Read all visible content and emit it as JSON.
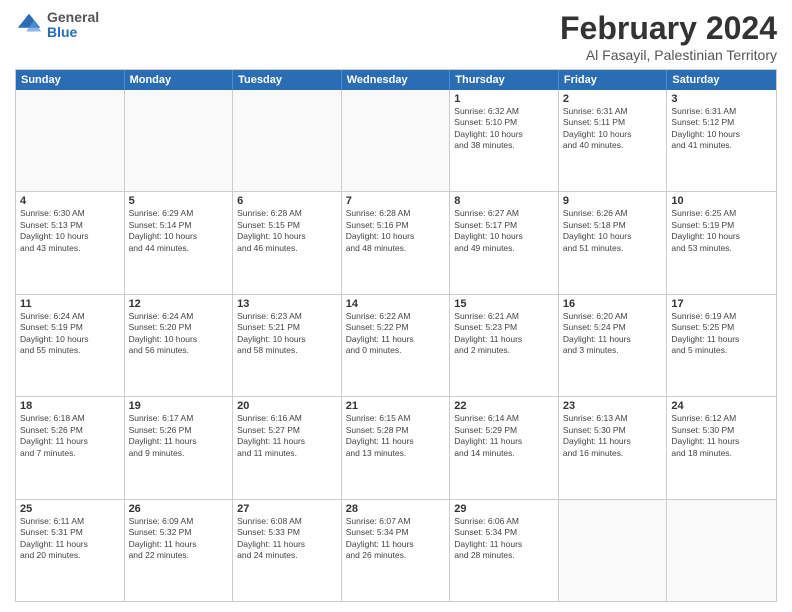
{
  "logo": {
    "general": "General",
    "blue": "Blue"
  },
  "title": "February 2024",
  "subtitle": "Al Fasayil, Palestinian Territory",
  "headers": [
    "Sunday",
    "Monday",
    "Tuesday",
    "Wednesday",
    "Thursday",
    "Friday",
    "Saturday"
  ],
  "weeks": [
    [
      {
        "day": "",
        "info": ""
      },
      {
        "day": "",
        "info": ""
      },
      {
        "day": "",
        "info": ""
      },
      {
        "day": "",
        "info": ""
      },
      {
        "day": "1",
        "info": "Sunrise: 6:32 AM\nSunset: 5:10 PM\nDaylight: 10 hours\nand 38 minutes."
      },
      {
        "day": "2",
        "info": "Sunrise: 6:31 AM\nSunset: 5:11 PM\nDaylight: 10 hours\nand 40 minutes."
      },
      {
        "day": "3",
        "info": "Sunrise: 6:31 AM\nSunset: 5:12 PM\nDaylight: 10 hours\nand 41 minutes."
      }
    ],
    [
      {
        "day": "4",
        "info": "Sunrise: 6:30 AM\nSunset: 5:13 PM\nDaylight: 10 hours\nand 43 minutes."
      },
      {
        "day": "5",
        "info": "Sunrise: 6:29 AM\nSunset: 5:14 PM\nDaylight: 10 hours\nand 44 minutes."
      },
      {
        "day": "6",
        "info": "Sunrise: 6:28 AM\nSunset: 5:15 PM\nDaylight: 10 hours\nand 46 minutes."
      },
      {
        "day": "7",
        "info": "Sunrise: 6:28 AM\nSunset: 5:16 PM\nDaylight: 10 hours\nand 48 minutes."
      },
      {
        "day": "8",
        "info": "Sunrise: 6:27 AM\nSunset: 5:17 PM\nDaylight: 10 hours\nand 49 minutes."
      },
      {
        "day": "9",
        "info": "Sunrise: 6:26 AM\nSunset: 5:18 PM\nDaylight: 10 hours\nand 51 minutes."
      },
      {
        "day": "10",
        "info": "Sunrise: 6:25 AM\nSunset: 5:19 PM\nDaylight: 10 hours\nand 53 minutes."
      }
    ],
    [
      {
        "day": "11",
        "info": "Sunrise: 6:24 AM\nSunset: 5:19 PM\nDaylight: 10 hours\nand 55 minutes."
      },
      {
        "day": "12",
        "info": "Sunrise: 6:24 AM\nSunset: 5:20 PM\nDaylight: 10 hours\nand 56 minutes."
      },
      {
        "day": "13",
        "info": "Sunrise: 6:23 AM\nSunset: 5:21 PM\nDaylight: 10 hours\nand 58 minutes."
      },
      {
        "day": "14",
        "info": "Sunrise: 6:22 AM\nSunset: 5:22 PM\nDaylight: 11 hours\nand 0 minutes."
      },
      {
        "day": "15",
        "info": "Sunrise: 6:21 AM\nSunset: 5:23 PM\nDaylight: 11 hours\nand 2 minutes."
      },
      {
        "day": "16",
        "info": "Sunrise: 6:20 AM\nSunset: 5:24 PM\nDaylight: 11 hours\nand 3 minutes."
      },
      {
        "day": "17",
        "info": "Sunrise: 6:19 AM\nSunset: 5:25 PM\nDaylight: 11 hours\nand 5 minutes."
      }
    ],
    [
      {
        "day": "18",
        "info": "Sunrise: 6:18 AM\nSunset: 5:26 PM\nDaylight: 11 hours\nand 7 minutes."
      },
      {
        "day": "19",
        "info": "Sunrise: 6:17 AM\nSunset: 5:26 PM\nDaylight: 11 hours\nand 9 minutes."
      },
      {
        "day": "20",
        "info": "Sunrise: 6:16 AM\nSunset: 5:27 PM\nDaylight: 11 hours\nand 11 minutes."
      },
      {
        "day": "21",
        "info": "Sunrise: 6:15 AM\nSunset: 5:28 PM\nDaylight: 11 hours\nand 13 minutes."
      },
      {
        "day": "22",
        "info": "Sunrise: 6:14 AM\nSunset: 5:29 PM\nDaylight: 11 hours\nand 14 minutes."
      },
      {
        "day": "23",
        "info": "Sunrise: 6:13 AM\nSunset: 5:30 PM\nDaylight: 11 hours\nand 16 minutes."
      },
      {
        "day": "24",
        "info": "Sunrise: 6:12 AM\nSunset: 5:30 PM\nDaylight: 11 hours\nand 18 minutes."
      }
    ],
    [
      {
        "day": "25",
        "info": "Sunrise: 6:11 AM\nSunset: 5:31 PM\nDaylight: 11 hours\nand 20 minutes."
      },
      {
        "day": "26",
        "info": "Sunrise: 6:09 AM\nSunset: 5:32 PM\nDaylight: 11 hours\nand 22 minutes."
      },
      {
        "day": "27",
        "info": "Sunrise: 6:08 AM\nSunset: 5:33 PM\nDaylight: 11 hours\nand 24 minutes."
      },
      {
        "day": "28",
        "info": "Sunrise: 6:07 AM\nSunset: 5:34 PM\nDaylight: 11 hours\nand 26 minutes."
      },
      {
        "day": "29",
        "info": "Sunrise: 6:06 AM\nSunset: 5:34 PM\nDaylight: 11 hours\nand 28 minutes."
      },
      {
        "day": "",
        "info": ""
      },
      {
        "day": "",
        "info": ""
      }
    ]
  ]
}
